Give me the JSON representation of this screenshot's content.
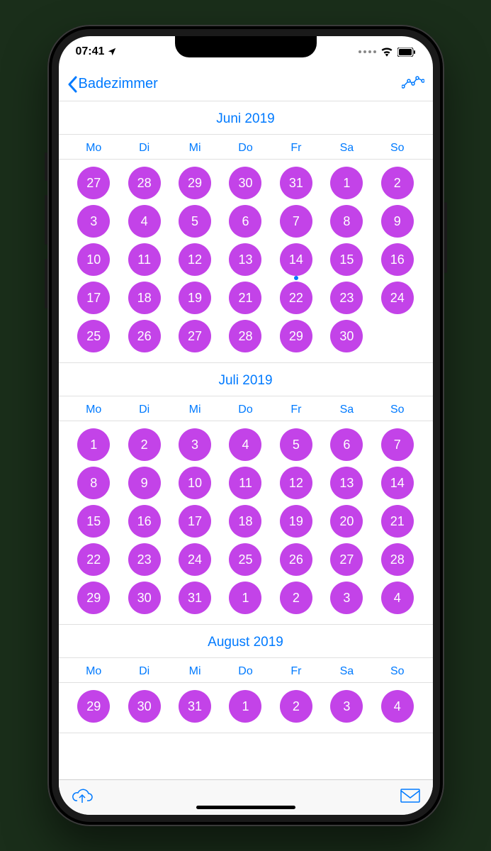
{
  "status": {
    "time": "07:41",
    "location_arrow": "➤"
  },
  "nav": {
    "back_label": "Badezimmer"
  },
  "weekdays": [
    "Mo",
    "Di",
    "Mi",
    "Do",
    "Fr",
    "Sa",
    "So"
  ],
  "months": [
    {
      "title": "Juni 2019",
      "today_index": 18,
      "days": [
        "27",
        "28",
        "29",
        "30",
        "31",
        "1",
        "2",
        "3",
        "4",
        "5",
        "6",
        "7",
        "8",
        "9",
        "10",
        "11",
        "12",
        "13",
        "14",
        "15",
        "16",
        "17",
        "18",
        "19",
        "21",
        "22",
        "23",
        "24",
        "25",
        "26",
        "27",
        "28",
        "29",
        "30"
      ]
    },
    {
      "title": "Juli 2019",
      "today_index": -1,
      "days": [
        "1",
        "2",
        "3",
        "4",
        "5",
        "6",
        "7",
        "8",
        "9",
        "10",
        "11",
        "12",
        "13",
        "14",
        "15",
        "16",
        "17",
        "18",
        "19",
        "20",
        "21",
        "22",
        "23",
        "24",
        "25",
        "26",
        "27",
        "28",
        "29",
        "30",
        "31",
        "1",
        "2",
        "3",
        "4"
      ]
    },
    {
      "title": "August 2019",
      "today_index": -1,
      "days": [
        "29",
        "30",
        "31",
        "1",
        "2",
        "3",
        "4"
      ]
    }
  ],
  "colors": {
    "accent": "#007aff",
    "day_marked": "#c343e8"
  }
}
